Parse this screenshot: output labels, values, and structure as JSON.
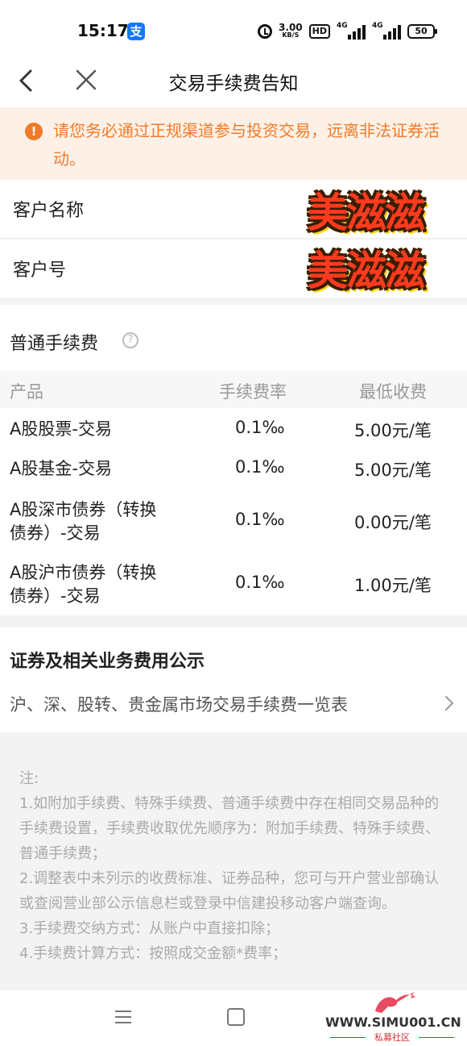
{
  "status_bar": {
    "time": "15:17",
    "alipay_icon": "支",
    "net_speed_value": "3.00",
    "net_speed_unit": "KB/S",
    "hd_label": "HD",
    "signal1_tag": "4G",
    "signal2_tag": "4G",
    "battery": "50"
  },
  "nav": {
    "title": "交易手续费告知",
    "back_icon": "chevron-left-icon",
    "close_icon": "close-icon"
  },
  "notice": {
    "icon_glyph": "!",
    "text": "请您务必通过正规渠道参与投资交易，远离非法证券活动。",
    "color": "#ef7b2a",
    "background": "#fdf1e7"
  },
  "customer": {
    "name_label": "客户名称",
    "id_label": "客户号"
  },
  "watermark": {
    "text1": "美滋滋",
    "text2": "美滋滋"
  },
  "fee_table": {
    "title": "普通手续费",
    "help_glyph": "?",
    "headers": [
      "产品",
      "手续费率",
      "最低收费"
    ],
    "rows": [
      {
        "product": "A股股票-交易",
        "rate": "0.1‰",
        "min": "5.00元/笔"
      },
      {
        "product": "A股基金-交易",
        "rate": "0.1‰",
        "min": "5.00元/笔"
      },
      {
        "product_line1": "A股深市债券（转换",
        "product_line2": "债券）-交易",
        "rate": "0.1‰",
        "min": "0.00元/笔"
      },
      {
        "product_line1": "A股沪市债券（转换",
        "product_line2": "债券）-交易",
        "rate": "0.1‰",
        "min": "1.00元/笔"
      }
    ]
  },
  "disclosure": {
    "title": "证券及相关业务费用公示",
    "link": "沪、深、股转、贵金属市场交易手续费一览表"
  },
  "notes": {
    "heading": "注:",
    "items": [
      "1.如附加手续费、特殊手续费、普通手续费中存在相同交易品种的手续费设置，手续费收取优先顺序为：附加手续费、特殊手续费、普通手续费；",
      "2.调整表中未列示的收费标准、证券品种，您可与开户营业部确认或查阅营业部公示信息栏或登录中信建投移动客户端查询。",
      "3.手续费交纳方式：从账户中直接扣除；",
      "4.手续费计算方式：按照成交金额*费率；"
    ]
  },
  "bottom": {
    "brand_url": "WWW.SIMU001.CN",
    "brand_sub": "私募社区"
  }
}
